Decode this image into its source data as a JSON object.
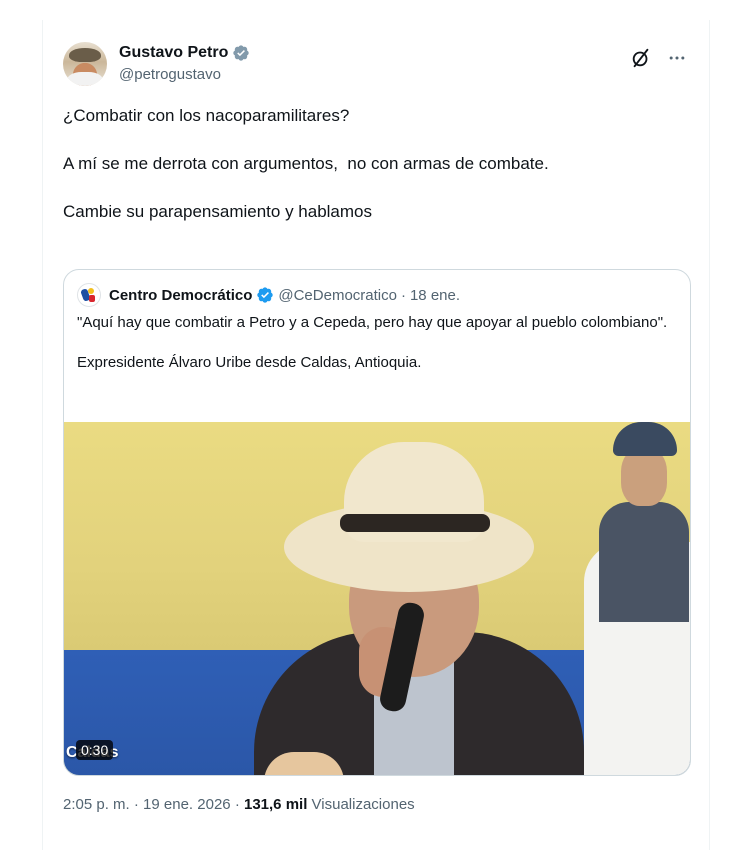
{
  "tweet": {
    "author_name": "Gustavo Petro",
    "author_handle": "@petrogustavo",
    "paragraphs": [
      "¿Combatir con los nacoparamilitares?",
      "A mí se me derrota con argumentos,  no con armas de combate.",
      "Cambie su parapensamiento y hablamos"
    ],
    "time": "2:05 p. m.",
    "separator": "·",
    "date": "19 ene. 2026",
    "views_count": "131,6 mil",
    "views_label": "Visualizaciones"
  },
  "quote": {
    "author_name": "Centro Democrático",
    "author_handle": "@CeDemocratico",
    "separator": "·",
    "date": "18 ene.",
    "paragraphs": [
      "\"Aquí hay que combatir a Petro y a Cepeda, pero hay que apoyar al pueblo colombiano\".",
      "Expresidente Álvaro Uribe desde Caldas, Antioquia."
    ],
    "video_duration": "0:30",
    "video_overlay_text": "Caldas"
  },
  "icons": {
    "verified": "verified-badge-icon",
    "grok": "grok-slash-icon",
    "more": "more-dots-icon"
  },
  "colors": {
    "verified_blue": "#829aab",
    "quote_verified_blue": "#1d9bf0",
    "secondary_text": "#536471"
  }
}
